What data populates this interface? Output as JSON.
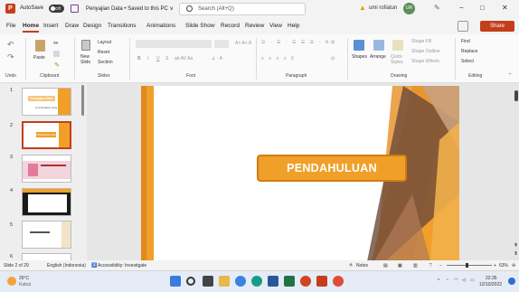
{
  "title_bar": {
    "logo_letter": "P",
    "autosave_label": "AutoSave",
    "autosave_state": "Off",
    "document_title": "Penyajian Data • Saved to this PC ∨",
    "search_placeholder": "Search (Alt+Q)",
    "user_name": "umi rofiatun",
    "user_initials": "UR",
    "minimize": "−",
    "restore": "□",
    "close": "✕"
  },
  "menu": {
    "tabs": [
      "File",
      "Home",
      "Insert",
      "Draw",
      "Design",
      "Transitions",
      "Animations",
      "Slide Show",
      "Record",
      "Review",
      "View",
      "Help"
    ],
    "active_tab": "Home",
    "comment_icon": "comment-icon",
    "share_label": "Share"
  },
  "ribbon": {
    "undo": {
      "label": "Undo"
    },
    "clipboard": {
      "paste": "Paste",
      "group": "Clipboard"
    },
    "slides": {
      "new_slide": "New Slide",
      "layout": "Layout",
      "reset": "Reset",
      "section": "Section",
      "group": "Slides"
    },
    "font": {
      "bold": "B",
      "italic": "I",
      "underline": "U",
      "strike": "S",
      "group": "Font"
    },
    "paragraph": {
      "group": "Paragraph"
    },
    "drawing": {
      "shapes": "Shapes",
      "arrange": "Arrange",
      "quick_styles": "Quick Styles",
      "shape_fill": "Shape Fill",
      "shape_outline": "Shape Outline",
      "shape_effects": "Shape Effects",
      "group": "Drawing"
    },
    "editing": {
      "find": "Find",
      "replace": "Replace",
      "select": "Select",
      "group": "Editing"
    }
  },
  "thumbnails": [
    {
      "num": "1",
      "text": "Penyajian Data",
      "subtitle": "Umi Rofiatun Nisa"
    },
    {
      "num": "2",
      "text": "PENDAHULUAN"
    },
    {
      "num": "3",
      "text": ""
    },
    {
      "num": "4",
      "text": ""
    },
    {
      "num": "5",
      "text": ""
    },
    {
      "num": "6",
      "text": ""
    }
  ],
  "slide": {
    "title": "PENDAHULUAN",
    "accent_color": "#f0a029",
    "accent_border": "#d27c12"
  },
  "status": {
    "slide_count": "Slide 2 of 29",
    "language": "English (Indonesia)",
    "accessibility": "Accessibility: Investigate",
    "notes": "Notes",
    "zoom": "63%"
  },
  "taskbar": {
    "weather_temp": "26°C",
    "weather_desc": "Kabut",
    "time": "22:35",
    "date": "12/10/2022",
    "apps": [
      "windows-icon",
      "search-icon",
      "taskview-icon",
      "explorer-icon",
      "chrome-icon",
      "edge-icon",
      "word-icon",
      "excel-icon",
      "powerpoint-icon",
      "acrobat-icon",
      "other-app-icon"
    ]
  }
}
